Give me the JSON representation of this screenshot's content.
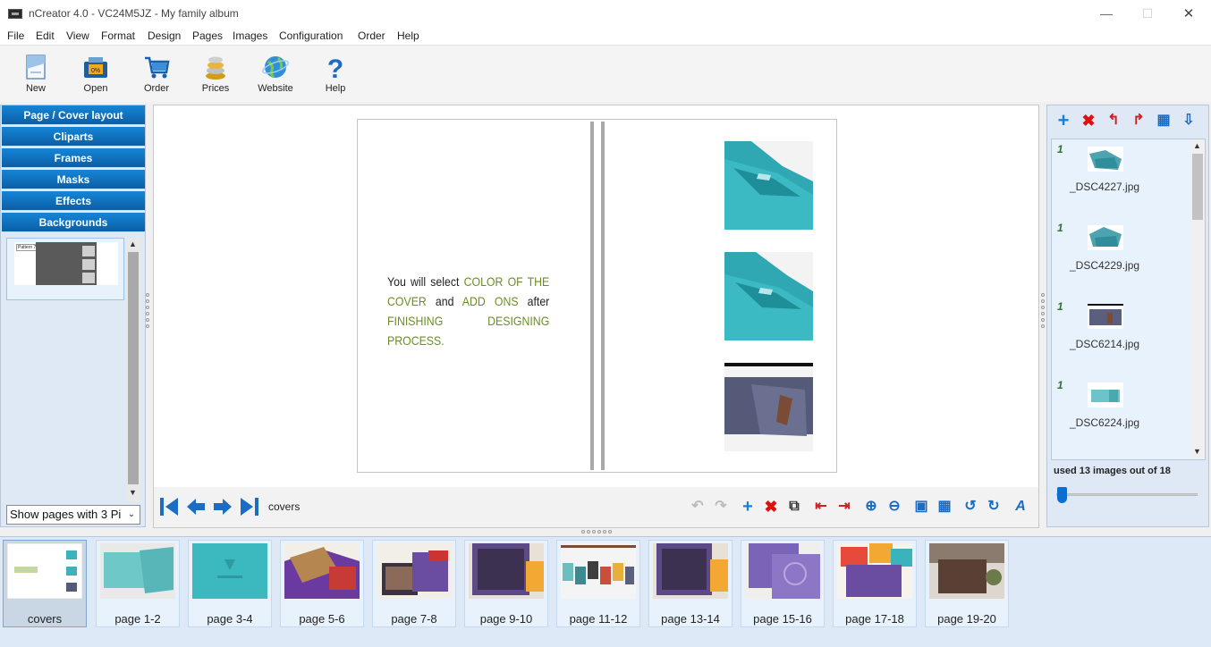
{
  "window": {
    "title": "nCreator 4.0 - VC24M5JZ - My family album",
    "minimize": "—",
    "maximize": "☐",
    "close": "✕"
  },
  "menu": [
    "File",
    "Edit",
    "View",
    "Format",
    "Design",
    "Pages",
    "Images",
    "Configuration",
    "Order",
    "Help"
  ],
  "toolbar": [
    {
      "label": "New",
      "icon": "new-document-icon"
    },
    {
      "label": "Open",
      "icon": "open-folder-icon"
    },
    {
      "label": "Order",
      "icon": "shopping-cart-icon"
    },
    {
      "label": "Prices",
      "icon": "coins-icon"
    },
    {
      "label": "Website",
      "icon": "globe-icon"
    },
    {
      "label": "Help",
      "icon": "question-icon"
    }
  ],
  "left_panel": {
    "sections": [
      "Page / Cover layout",
      "Cliparts",
      "Frames",
      "Masks",
      "Effects",
      "Backgrounds"
    ],
    "layout_thumb_label": "Pattern 74",
    "show_pages_select": "Show pages with 3 Pi"
  },
  "canvas": {
    "text_plain_1": "You will select ",
    "text_hl_1": "COLOR OF THE COVER",
    "text_plain_2": " and ",
    "text_hl_2": "ADD ONS",
    "text_plain_3": " after ",
    "text_hl_3": "FINISHING DESIGNING PROCESS.",
    "current_page": "covers"
  },
  "right_panel": {
    "images": [
      {
        "name": "_DSC4227.jpg",
        "marker": "1"
      },
      {
        "name": "_DSC4229.jpg",
        "marker": "1"
      },
      {
        "name": "_DSC6214.jpg",
        "marker": "1"
      },
      {
        "name": "_DSC6224.jpg",
        "marker": "1"
      }
    ],
    "used_text": "used 13 images out of 18"
  },
  "filmstrip": {
    "pages": [
      "covers",
      "page 1-2",
      "page 3-4",
      "page 5-6",
      "page 7-8",
      "page 9-10",
      "page 11-12",
      "page 13-14",
      "page 15-16",
      "page 17-18",
      "page 19-20"
    ],
    "selected_index": 0
  },
  "colors": {
    "accent_blue": "#0b6fc7",
    "highlight_text": "#6b8e23",
    "teal_box": "#3bb3bd",
    "purple_box": "#6a4da0"
  }
}
